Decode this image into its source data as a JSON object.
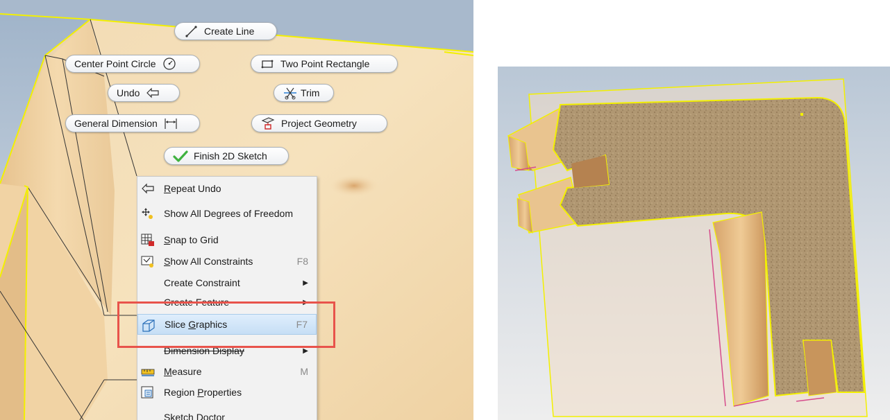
{
  "marking_menu": {
    "create_line": "Create Line",
    "center_point_circle": "Center Point Circle",
    "two_point_rectangle": "Two Point Rectangle",
    "undo": "Undo",
    "trim": "Trim",
    "general_dimension": "General Dimension",
    "project_geometry": "Project Geometry",
    "finish_2d_sketch": "Finish 2D Sketch"
  },
  "context_menu": {
    "repeat_undo": {
      "pre": "",
      "u": "R",
      "post": "epeat Undo"
    },
    "show_all_dof": {
      "pre": "Show All Degrees of Freedom",
      "u": "",
      "post": ""
    },
    "snap_to_grid": {
      "pre": "",
      "u": "S",
      "post": "nap to Grid"
    },
    "show_all_constraints": {
      "pre": "",
      "u": "S",
      "post": "how All Constraints",
      "key": "F8"
    },
    "create_constraint": {
      "pre": "Create Constraint",
      "u": "",
      "post": ""
    },
    "create_feature": {
      "pre": "Create Feature",
      "u": "",
      "post": ""
    },
    "slice_graphics": {
      "pre": "Slice ",
      "u": "G",
      "post": "raphics",
      "key": "F7"
    },
    "dimension_display": {
      "pre": "Dimension Display",
      "u": "",
      "post": ""
    },
    "measure": {
      "pre": "",
      "u": "M",
      "post": "easure",
      "key": "M"
    },
    "region_properties": {
      "pre": "Region ",
      "u": "P",
      "post": "roperties"
    },
    "sketch_doctor": {
      "pre": "Sketch Doctor",
      "u": "",
      "post": ""
    }
  },
  "colors": {
    "highlight_box": "#e8534b",
    "sketch_outline": "#f3f000",
    "wood": "#e8c79a",
    "section_fill": "#a98f6a"
  },
  "icons": [
    "line-icon",
    "circle-icon",
    "rectangle-icon",
    "undo-icon",
    "trim-icon",
    "dimension-icon",
    "project-geometry-icon",
    "checkmark-icon",
    "degrees-of-freedom-icon",
    "snap-grid-icon",
    "constraints-icon",
    "slice-graphics-icon",
    "measure-icon",
    "region-properties-icon"
  ]
}
